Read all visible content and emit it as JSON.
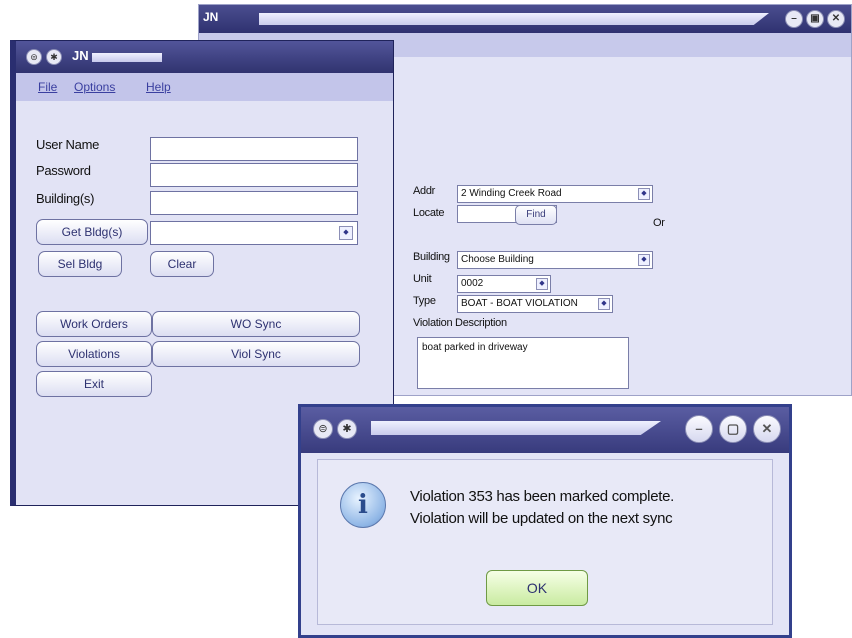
{
  "bg_window": {
    "logo_text": "JN",
    "buttons": [
      "–",
      "▣",
      "✕"
    ],
    "addr_label": "Addr",
    "addr_value": "2 Winding Creek Road",
    "locate_label": "Locate",
    "find_label": "Find",
    "or_label": "Or",
    "building_label": "Building",
    "building_value": "Choose Building",
    "unit_label": "Unit",
    "unit_value": "0002",
    "type_label": "Type",
    "type_value": "BOAT - BOAT VIOLATION",
    "violation_desc_label": "Violation Description",
    "violation_desc_value": "boat parked in driveway"
  },
  "main_window": {
    "logo_text": "JN",
    "menu": [
      "File",
      "Options",
      "Help"
    ],
    "user_name_label": "User Name",
    "password_label": "Password",
    "buildings_label": "Building(s)",
    "get_bldgs_label": "Get Bldg(s)",
    "sel_bldg_label": "Sel Bldg",
    "clear_label": "Clear",
    "work_orders_label": "Work Orders",
    "wo_sync_label": "WO Sync",
    "violations_label": "Violations",
    "viol_sync_label": "Viol Sync",
    "exit_label": "Exit"
  },
  "dialog": {
    "line1": "Violation 353 has been marked complete.",
    "line2": "Violation will be updated on the next sync",
    "ok_label": "OK"
  },
  "colors": {
    "titlebar": "#30336f",
    "window_bg": "#e2e3f5",
    "ok_button": "#c9eba1"
  }
}
